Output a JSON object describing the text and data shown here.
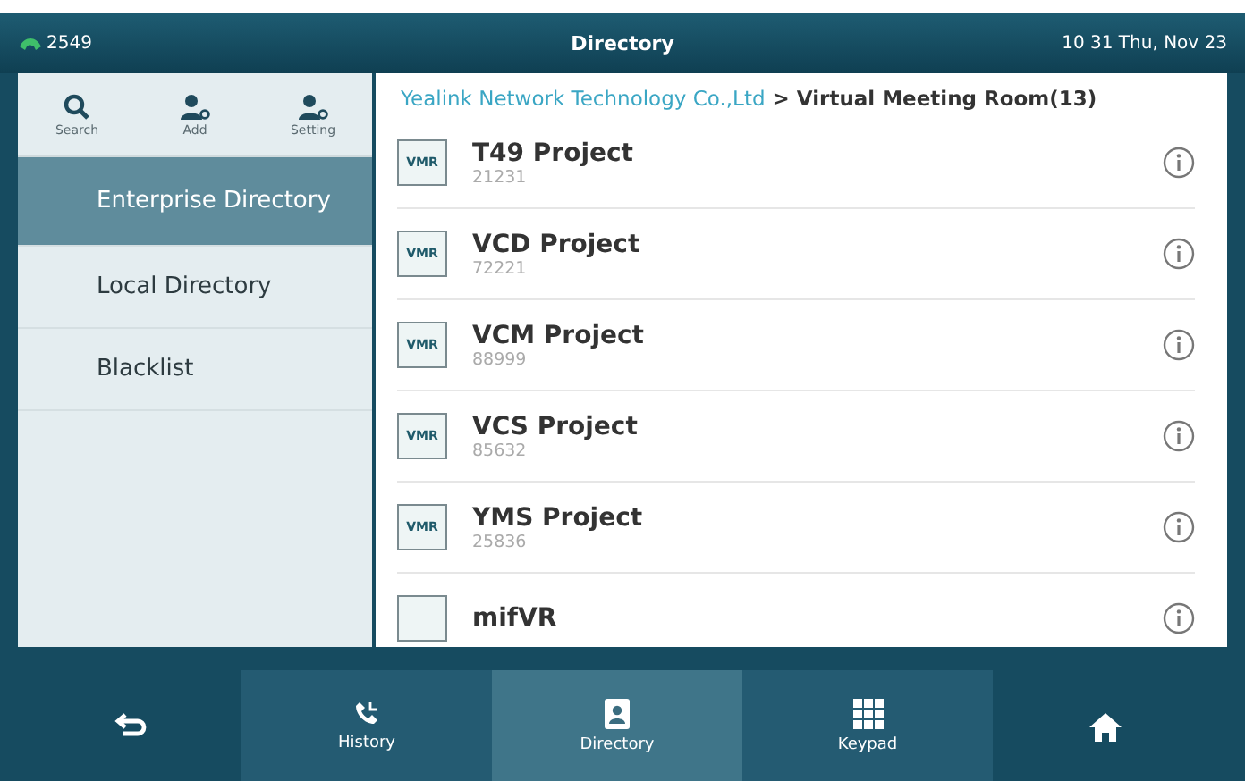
{
  "status_bar": {
    "account": "2549",
    "title": "Directory",
    "datetime": "10 31 Thu, Nov 23"
  },
  "toolbar": [
    {
      "kind": "search",
      "label": "Search"
    },
    {
      "kind": "add",
      "label": "Add"
    },
    {
      "kind": "setting",
      "label": "Setting"
    }
  ],
  "sidebar": {
    "items": [
      {
        "label": "Enterprise Directory",
        "selected": true
      },
      {
        "label": "Local Directory",
        "selected": false
      },
      {
        "label": "Blacklist",
        "selected": false
      }
    ]
  },
  "breadcrumb": {
    "parent": "Yealink Network Technology Co.,Ltd",
    "separator": ">",
    "current": "Virtual Meeting Room(13)"
  },
  "contacts": [
    {
      "badge": "VMR",
      "name": "T49 Project",
      "number": "21231"
    },
    {
      "badge": "VMR",
      "name": "VCD Project",
      "number": "72221"
    },
    {
      "badge": "VMR",
      "name": "VCM Project",
      "number": "88999"
    },
    {
      "badge": "VMR",
      "name": "VCS Project",
      "number": "85632"
    },
    {
      "badge": "VMR",
      "name": "YMS Project",
      "number": "25836"
    },
    {
      "name": "mifVR"
    }
  ],
  "softkeys": [
    {
      "kind": "back",
      "selected": false
    },
    {
      "kind": "history",
      "label": "History",
      "selected": false
    },
    {
      "kind": "directory",
      "label": "Directory",
      "selected": true
    },
    {
      "kind": "keypad",
      "label": "Keypad",
      "selected": false
    },
    {
      "kind": "home",
      "selected": false
    }
  ]
}
